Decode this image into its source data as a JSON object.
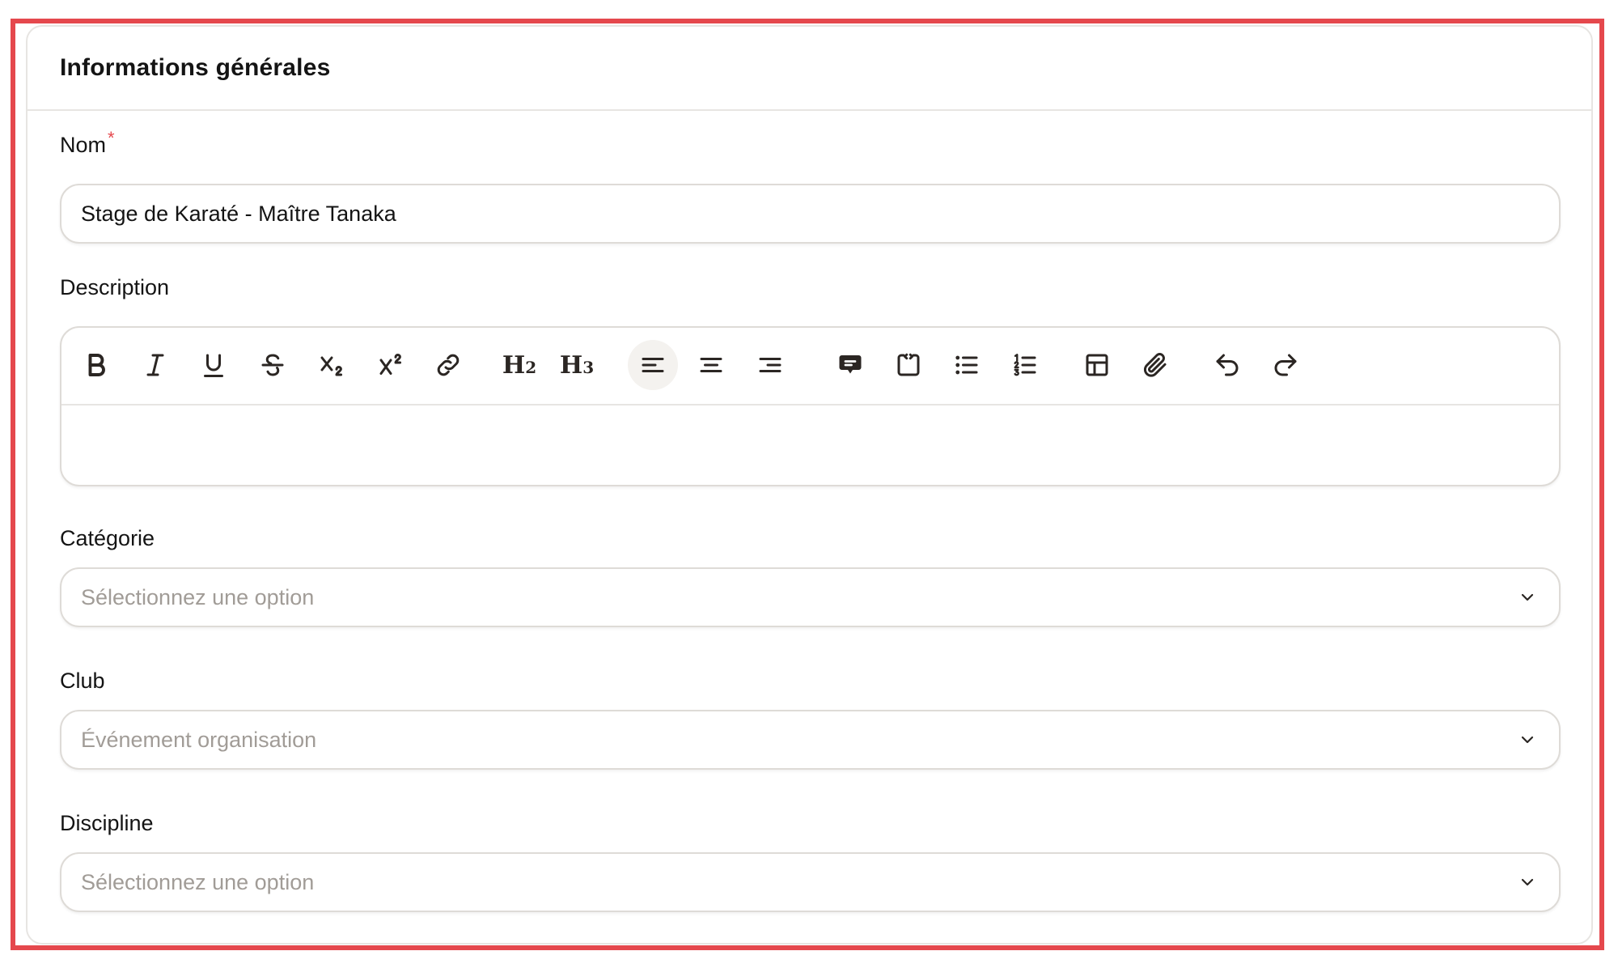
{
  "card": {
    "title": "Informations générales"
  },
  "fields": {
    "nom": {
      "label": "Nom",
      "required_marker": "*",
      "value": "Stage de Karaté - Maître Tanaka"
    },
    "description": {
      "label": "Description",
      "toolbar": [
        {
          "name": "bold-icon"
        },
        {
          "name": "italic-icon"
        },
        {
          "name": "underline-icon"
        },
        {
          "name": "strikethrough-icon"
        },
        {
          "name": "subscript-icon"
        },
        {
          "name": "superscript-icon"
        },
        {
          "name": "link-icon"
        },
        {
          "name": "heading-2-icon",
          "glyph": "H2"
        },
        {
          "name": "heading-3-icon",
          "glyph": "H3"
        },
        {
          "name": "align-left-icon",
          "active": true
        },
        {
          "name": "align-center-icon"
        },
        {
          "name": "align-right-icon"
        },
        {
          "name": "comment-icon"
        },
        {
          "name": "code-block-icon"
        },
        {
          "name": "bullet-list-icon"
        },
        {
          "name": "ordered-list-icon"
        },
        {
          "name": "table-icon"
        },
        {
          "name": "attachment-icon"
        },
        {
          "name": "undo-icon"
        },
        {
          "name": "redo-icon"
        }
      ],
      "value": ""
    },
    "categorie": {
      "label": "Catégorie",
      "placeholder": "Sélectionnez une option"
    },
    "club": {
      "label": "Club",
      "placeholder": "Événement organisation"
    },
    "discipline": {
      "label": "Discipline",
      "placeholder": "Sélectionnez une option"
    }
  },
  "colors": {
    "accent_red": "#e5484d",
    "border": "#dedbd7",
    "placeholder": "#a19c97",
    "text": "#141414"
  }
}
